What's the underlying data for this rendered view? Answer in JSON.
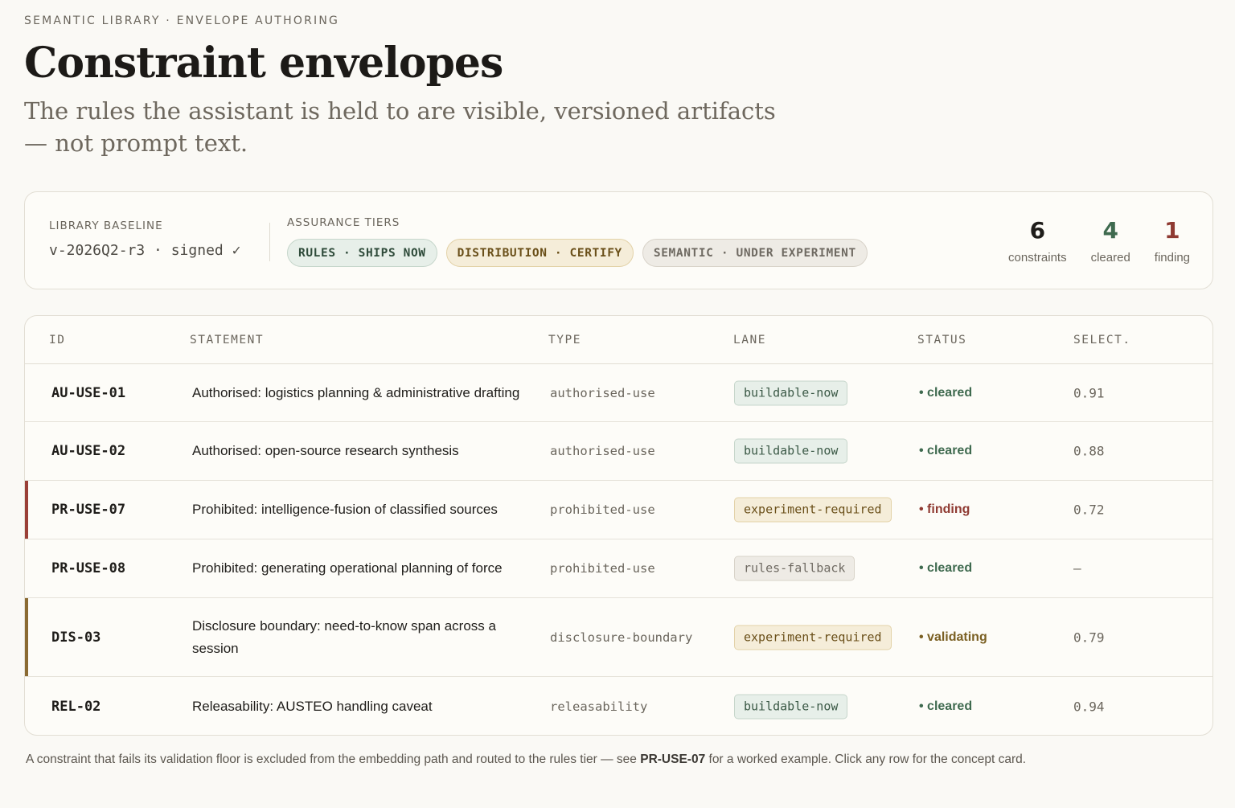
{
  "header": {
    "eyebrow": "SEMANTIC LIBRARY · ENVELOPE AUTHORING",
    "title": "Constraint envelopes",
    "subtitle": "The rules the assistant is held to are visible, versioned artifacts — not prompt text."
  },
  "baseline": {
    "label": "LIBRARY BASELINE",
    "value": "v-2026Q2-r3 · signed ✓"
  },
  "tiers": {
    "label": "ASSURANCE TIERS",
    "items": [
      {
        "label": "RULES · SHIPS NOW",
        "tone": "green"
      },
      {
        "label": "DISTRIBUTION · CERTIFY",
        "tone": "amber"
      },
      {
        "label": "SEMANTIC · UNDER EXPERIMENT",
        "tone": "grey"
      }
    ]
  },
  "stats": [
    {
      "value": "6",
      "label": "constraints",
      "tone": "dark"
    },
    {
      "value": "4",
      "label": "cleared",
      "tone": "green"
    },
    {
      "value": "1",
      "label": "finding",
      "tone": "red"
    }
  ],
  "table": {
    "columns": [
      "ID",
      "STATEMENT",
      "TYPE",
      "LANE",
      "STATUS",
      "SELECT."
    ],
    "rows": [
      {
        "id": "AU-USE-01",
        "statement": "Authorised: logistics planning & administrative drafting",
        "type": "authorised-use",
        "lane": "buildable-now",
        "lane_tone": "green",
        "status": "• cleared",
        "status_tone": "cleared",
        "select": "0.91",
        "flag": ""
      },
      {
        "id": "AU-USE-02",
        "statement": "Authorised: open-source research synthesis",
        "type": "authorised-use",
        "lane": "buildable-now",
        "lane_tone": "green",
        "status": "• cleared",
        "status_tone": "cleared",
        "select": "0.88",
        "flag": ""
      },
      {
        "id": "PR-USE-07",
        "statement": "Prohibited: intelligence-fusion of classified sources",
        "type": "prohibited-use",
        "lane": "experiment-required",
        "lane_tone": "amber",
        "status": "• finding",
        "status_tone": "finding",
        "select": "0.72",
        "flag": "red"
      },
      {
        "id": "PR-USE-08",
        "statement": "Prohibited: generating operational planning of force",
        "type": "prohibited-use",
        "lane": "rules-fallback",
        "lane_tone": "grey",
        "status": "• cleared",
        "status_tone": "cleared",
        "select": "—",
        "flag": ""
      },
      {
        "id": "DIS-03",
        "statement": "Disclosure boundary: need-to-know span across a session",
        "type": "disclosure-boundary",
        "lane": "experiment-required",
        "lane_tone": "amber",
        "status": "• validating",
        "status_tone": "validating",
        "select": "0.79",
        "flag": "amber"
      },
      {
        "id": "REL-02",
        "statement": "Releasability: AUSTEO handling caveat",
        "type": "releasability",
        "lane": "buildable-now",
        "lane_tone": "green",
        "status": "• cleared",
        "status_tone": "cleared",
        "select": "0.94",
        "flag": ""
      }
    ]
  },
  "footnote": {
    "before": "A constraint that fails its validation floor is excluded from the embedding path and routed to the rules tier — see ",
    "ref": "PR-USE-07",
    "after": " for a worked example. Click any row for the concept card."
  }
}
